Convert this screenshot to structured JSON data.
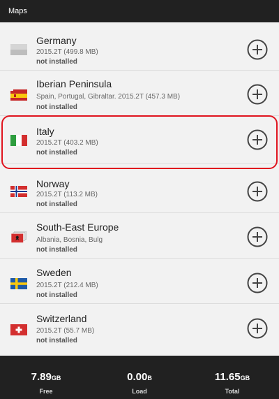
{
  "appbar": {
    "title": "Maps"
  },
  "maps": [
    {
      "name": "Germany",
      "detail": "2015.2T  (499.8 MB)",
      "status": "not installed",
      "flag": "grey-flag-icon"
    },
    {
      "name": "Iberian Peninsula",
      "detail": "Spain, Portugal, Gibraltar. 2015.2T  (457.3 MB)",
      "status": "not installed",
      "flag": "spain-flag-icon"
    },
    {
      "name": "Italy",
      "detail": "2015.2T  (403.2 MB)",
      "status": "not installed",
      "flag": "italy-flag-icon"
    },
    {
      "name": "Norway",
      "detail": "2015.2T  (113.2 MB)",
      "status": "not installed",
      "flag": "norway-flag-icon"
    },
    {
      "name": "South-East Europe",
      "detail": "Albania, Bosnia, Bulg",
      "status": "not installed",
      "flag": "albania-flag-icon"
    },
    {
      "name": "Sweden",
      "detail": "2015.2T  (212.4 MB)",
      "status": "not installed",
      "flag": "sweden-flag-icon"
    },
    {
      "name": "Switzerland",
      "detail": "2015.2T  (55.7 MB)",
      "status": "not installed",
      "flag": "switzerland-flag-icon"
    }
  ],
  "footer": {
    "free": {
      "value": "7.89",
      "unit": "GB",
      "label": "Free"
    },
    "load": {
      "value": "0.00",
      "unit": "B",
      "label": "Load"
    },
    "total": {
      "value": "11.65",
      "unit": "GB",
      "label": "Total"
    }
  },
  "colors": {
    "highlight": "#e0141e",
    "bar": "#212121"
  }
}
